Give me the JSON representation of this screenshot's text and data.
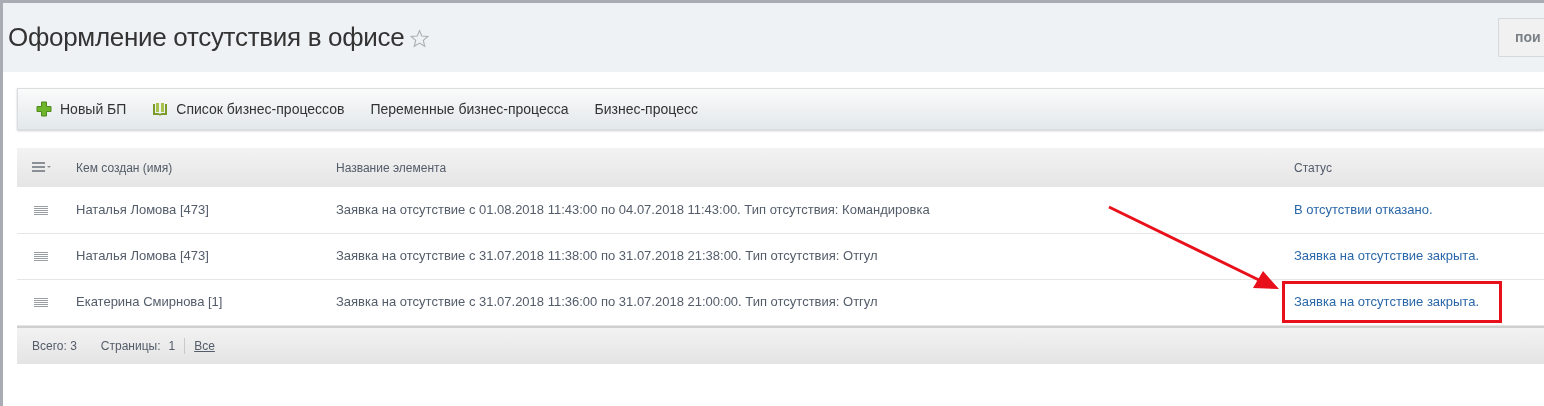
{
  "page": {
    "title": "Оформление отсутствия в офисе",
    "favorite": false,
    "button_cut": "пои"
  },
  "toolbar": [
    {
      "kind": "plus",
      "label": "Новый БП"
    },
    {
      "kind": "book",
      "label": "Список бизнес-процессов"
    },
    {
      "kind": "plain",
      "label": "Переменные бизнес-процесса"
    },
    {
      "kind": "plain",
      "label": "Бизнес-процесс"
    }
  ],
  "table": {
    "columns": [
      "Кем создан (имя)",
      "Название элемента",
      "Статус"
    ],
    "rows": [
      {
        "author": "Наталья Ломова [473]",
        "name": "Заявка на отсутствие с 01.08.2018 11:43:00 по 04.07.2018 11:43:00. Тип отсутствия: Командировка",
        "status": "В отсутствии отказано.",
        "highlighted": false
      },
      {
        "author": "Наталья Ломова [473]",
        "name": "Заявка на отсутствие с 31.07.2018 11:38:00 по 31.07.2018 21:38:00. Тип отсутствия: Отгул",
        "status": "Заявка на отсутствие закрыта.",
        "highlighted": false
      },
      {
        "author": "Екатерина Смирнова [1]",
        "name": "Заявка на отсутствие с 31.07.2018 11:36:00 по 31.07.2018 21:00:00. Тип отсутствия: Отгул",
        "status": "Заявка на отсутствие закрыта.",
        "highlighted": true
      }
    ]
  },
  "footer": {
    "total": "Всего: 3",
    "pages_label": "Страницы:",
    "page": "1",
    "all": "Все"
  }
}
